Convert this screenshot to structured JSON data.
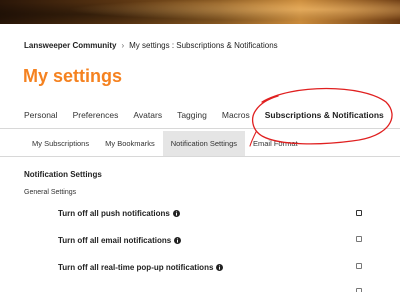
{
  "breadcrumb": {
    "root": "Lansweeper Community",
    "separator": "›",
    "current": "My settings : Subscriptions & Notifications"
  },
  "page": {
    "title": "My settings"
  },
  "tabs": [
    {
      "label": "Personal",
      "active": false
    },
    {
      "label": "Preferences",
      "active": false
    },
    {
      "label": "Avatars",
      "active": false
    },
    {
      "label": "Tagging",
      "active": false
    },
    {
      "label": "Macros",
      "active": false
    },
    {
      "label": "Subscriptions & Notifications",
      "active": true
    }
  ],
  "subtabs": [
    {
      "label": "My Subscriptions",
      "active": false
    },
    {
      "label": "My Bookmarks",
      "active": false
    },
    {
      "label": "Notification Settings",
      "active": true
    },
    {
      "label": "Email Format",
      "active": false
    }
  ],
  "notifications": {
    "heading": "Notification Settings",
    "group": "General Settings",
    "settings": [
      {
        "label": "Turn off all push notifications",
        "info_icon": "info-icon",
        "checked": false
      },
      {
        "label": "Turn off all email notifications",
        "info_icon": "info-icon",
        "checked": false
      },
      {
        "label": "Turn off all real-time pop-up notifications",
        "info_icon": "info-icon",
        "checked": false
      },
      {
        "label": "",
        "info_icon": "info-icon",
        "checked": false
      }
    ]
  },
  "colors": {
    "accent": "#f58220",
    "annotation": "#e02020",
    "active_subtab": "#e5e5e5"
  }
}
